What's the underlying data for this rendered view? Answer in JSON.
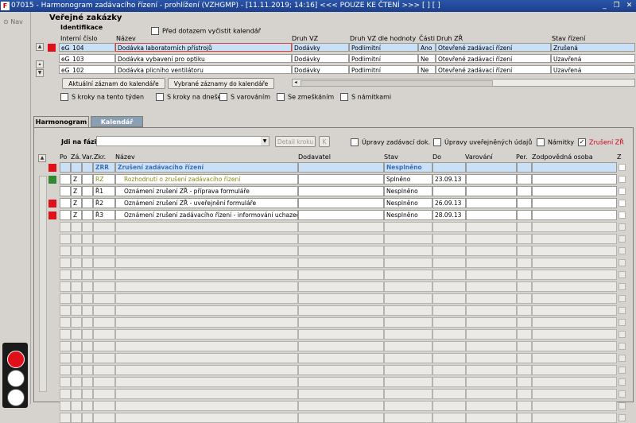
{
  "window": {
    "title": "07015 - Harmonogram zadávacího řízení - prohlížení (VZHGMP) - [11.11.2019; 14:16] <<< POUZE KE ČTENÍ >>>  [ ]  [ ]",
    "app_icon": "F",
    "min_icon": "_",
    "restore_icon": "❐",
    "close_icon": "✕"
  },
  "nav": {
    "label": "Nav"
  },
  "section": {
    "title": "Veřejné zakázky",
    "identifikace": "Identifikace",
    "clear_calendar_label": "Před dotazem vyčistit kalendář",
    "clear_calendar_checked": false
  },
  "contracts": {
    "columns": [
      "Interní číslo",
      "Název",
      "Druh VZ",
      "Druh VZ dle hodnoty",
      "Části",
      "Druh ZŘ",
      "Stav řízení"
    ],
    "rows": [
      {
        "id": "eG_104",
        "name": "Dodávka laboratorních přístrojů",
        "druh": "Dodávky",
        "hodnota": "Podlimitní",
        "casti": "Ano",
        "druhzr": "Otevřené zadávací řízení",
        "stav": "Zrušená",
        "flag": "red"
      },
      {
        "id": "eG_103",
        "name": "Dodávka vybavení pro optiku",
        "druh": "Dodávky",
        "hodnota": "Podlimitní",
        "casti": "Ne",
        "druhzr": "Otevřené zadávací řízení",
        "stav": "Uzavřená",
        "flag": ""
      },
      {
        "id": "eG_102",
        "name": "Dodávka plicního ventilátoru",
        "druh": "Dodávky",
        "hodnota": "Podlimitní",
        "casti": "Ne",
        "druhzr": "Otevřené zadávací řízení",
        "stav": "Uzavřená",
        "flag": ""
      }
    ]
  },
  "buttons": {
    "current_record": "Aktuální záznam do kalendáře",
    "selected_records": "Vybrané záznamy do kalendáře"
  },
  "filters": [
    {
      "label": "S kroky na tento týden",
      "checked": false
    },
    {
      "label": "S kroky na dnešek",
      "checked": false
    },
    {
      "label": "S varováním",
      "checked": false
    },
    {
      "label": "Se zmeškáním",
      "checked": false
    },
    {
      "label": "S námitkami",
      "checked": false
    }
  ],
  "tabs": [
    "Harmonogram",
    "Kalendář"
  ],
  "harmonogram": {
    "goto_label": "Jdi na fázi",
    "goto_value": "",
    "detail_button": "Detail kroku",
    "k_button": "K",
    "options": [
      {
        "label": "Úpravy zadávací dok.",
        "checked": false
      },
      {
        "label": "Úpravy uveřejněných údajů",
        "checked": false
      },
      {
        "label": "Námitky",
        "checked": false
      },
      {
        "label": "Zrušení ZŘ",
        "checked": true,
        "color": "#d0001a"
      }
    ],
    "columns": [
      "Po",
      "Zá.",
      "Var.",
      "Zkr.",
      "Název",
      "Dodavatel",
      "Stav",
      "Do",
      "Varování",
      "Per.",
      "Zodpovědná osoba",
      "Z"
    ],
    "rows": [
      {
        "flag": "red",
        "za": "",
        "var": "",
        "zkr": "ZRR",
        "nazev": "Zrušení zadávacího řízení",
        "dodavatel": "",
        "stav": "Nesplněno",
        "do": "",
        "style": "head"
      },
      {
        "flag": "green",
        "za": "Z",
        "var": "",
        "zkr": "RZ",
        "nazev": "Rozhodnutí o zrušení zadávacího řízení",
        "dodavatel": "",
        "stav": "Splněno",
        "do": "23.09.13",
        "style": "olive"
      },
      {
        "flag": "",
        "za": "Z",
        "var": "",
        "zkr": "Ř1",
        "nazev": "Oznámení zrušení ZŘ - příprava formuláře",
        "dodavatel": "",
        "stav": "Nesplněno",
        "do": "",
        "style": ""
      },
      {
        "flag": "red",
        "za": "Z",
        "var": "",
        "zkr": "Ř2",
        "nazev": "Oznámení zrušení ZŘ - uveřejnění formuláře",
        "dodavatel": "",
        "stav": "Nesplněno",
        "do": "26.09.13",
        "style": ""
      },
      {
        "flag": "red",
        "za": "Z",
        "var": "",
        "zkr": "Ř3",
        "nazev": "Oznámení zrušení zadávacího řízení - informování uchazečů",
        "dodavatel": "",
        "stav": "Nesplněno",
        "do": "28.09.13",
        "style": ""
      }
    ]
  },
  "colors": {
    "flag_red": "#e0101a",
    "flag_green": "#2f8a2f",
    "selected_row": "#c9e0f7",
    "title_blue": "#2a55a8",
    "head_text": "#3a6fb8",
    "olive_text": "#8a8a1a"
  }
}
